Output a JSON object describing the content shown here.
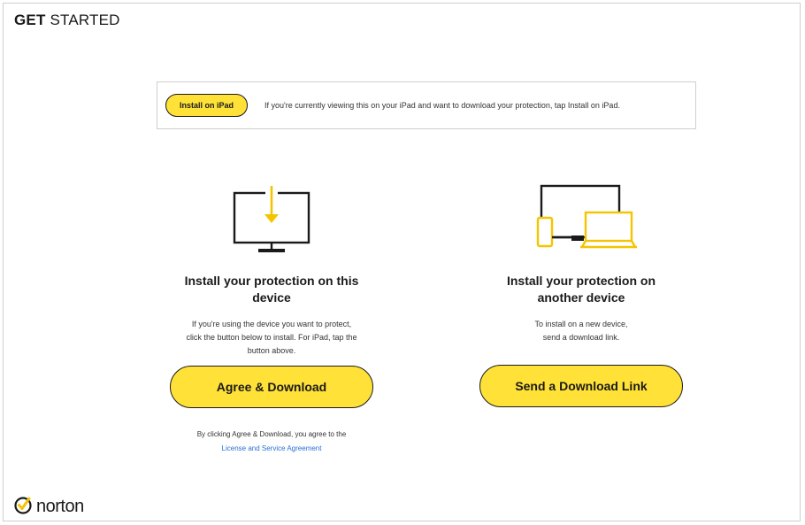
{
  "header": {
    "title_bold": "GET",
    "title_rest": " STARTED"
  },
  "ipad_banner": {
    "button_label": "Install on iPad",
    "text": "If you're currently viewing this on your iPad and want to download your protection, tap Install on iPad."
  },
  "this_device": {
    "icon": "monitor-download-icon",
    "heading_line1": "Install your protection on this",
    "heading_line2": "device",
    "desc_line1": "If you're using the device you want to protect,",
    "desc_line2": "click the button below to install. For iPad, tap the",
    "desc_line3": "button above.",
    "button_label": "Agree & Download",
    "legal_text": "By clicking Agree & Download, you agree to the",
    "legal_link": "License and Service Agreement"
  },
  "other_device": {
    "icon": "multiple-devices-icon",
    "heading_line1": "Install your protection on",
    "heading_line2": "another device",
    "desc_line1": "To install on a new device,",
    "desc_line2": "send a download link.",
    "button_label": "Send a Download Link"
  },
  "brand": {
    "name": "norton",
    "logo_icon": "norton-check-icon"
  },
  "colors": {
    "accent_yellow": "#ffe137",
    "link_blue": "#2a6fd6",
    "text_dark": "#1a1a1a"
  }
}
